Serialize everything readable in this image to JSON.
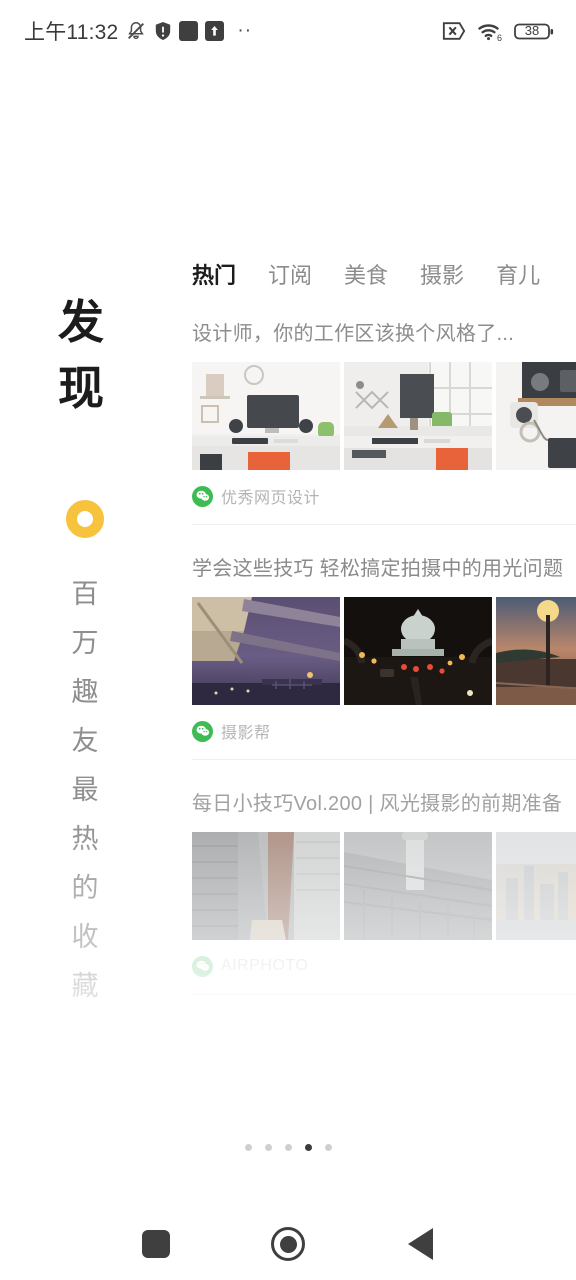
{
  "statusbar": {
    "time": "上午11:32",
    "icons_left": [
      "mute-bell-icon",
      "shield-icon",
      "dark-square-icon",
      "upload-box-icon",
      "more-dots-icon"
    ],
    "more_dots": "··",
    "icons_right": [
      "no-sim-icon",
      "wifi6-icon",
      "battery-icon"
    ],
    "battery_level": "38"
  },
  "left_panel": {
    "title_chars": [
      "发",
      "现"
    ],
    "ring_color": "#f7c23c",
    "subtitle_chars": [
      "百",
      "万",
      "趣",
      "友",
      "最",
      "热",
      "的",
      "收",
      "藏"
    ]
  },
  "card": {
    "tabs": [
      {
        "label": "热门",
        "active": true
      },
      {
        "label": "订阅",
        "active": false
      },
      {
        "label": "美食",
        "active": false
      },
      {
        "label": "摄影",
        "active": false
      },
      {
        "label": "育儿",
        "active": false
      }
    ],
    "posts": [
      {
        "title": "设计师，你的工作区该换个风格了...",
        "source": "优秀网页设计",
        "source_icon": "wechat-icon",
        "thumbs": [
          "workspace-white-desk",
          "workspace-window-desk",
          "workspace-shelf-keyboard"
        ]
      },
      {
        "title": "学会这些技巧 轻松搞定拍摄中的用光问题",
        "source": "摄影帮",
        "source_icon": "wechat-icon",
        "thumbs": [
          "bridge-at-dusk",
          "capitol-night-traffic",
          "street-lamps-sunset"
        ]
      },
      {
        "title": "每日小技巧Vol.200 | 风光摄影的前期准备",
        "source": "AIRPHOTO",
        "source_icon": "wechat-icon",
        "thumbs": [
          "skyscraper-facade",
          "tower-between-buildings",
          "city-skyline-golden"
        ]
      }
    ]
  },
  "pager": {
    "count": 5,
    "active_index": 3
  },
  "navbar": {
    "buttons": [
      {
        "name": "recents-button",
        "icon": "square-icon"
      },
      {
        "name": "home-button",
        "icon": "circle-icon"
      },
      {
        "name": "back-button",
        "icon": "triangle-left-icon"
      }
    ]
  }
}
